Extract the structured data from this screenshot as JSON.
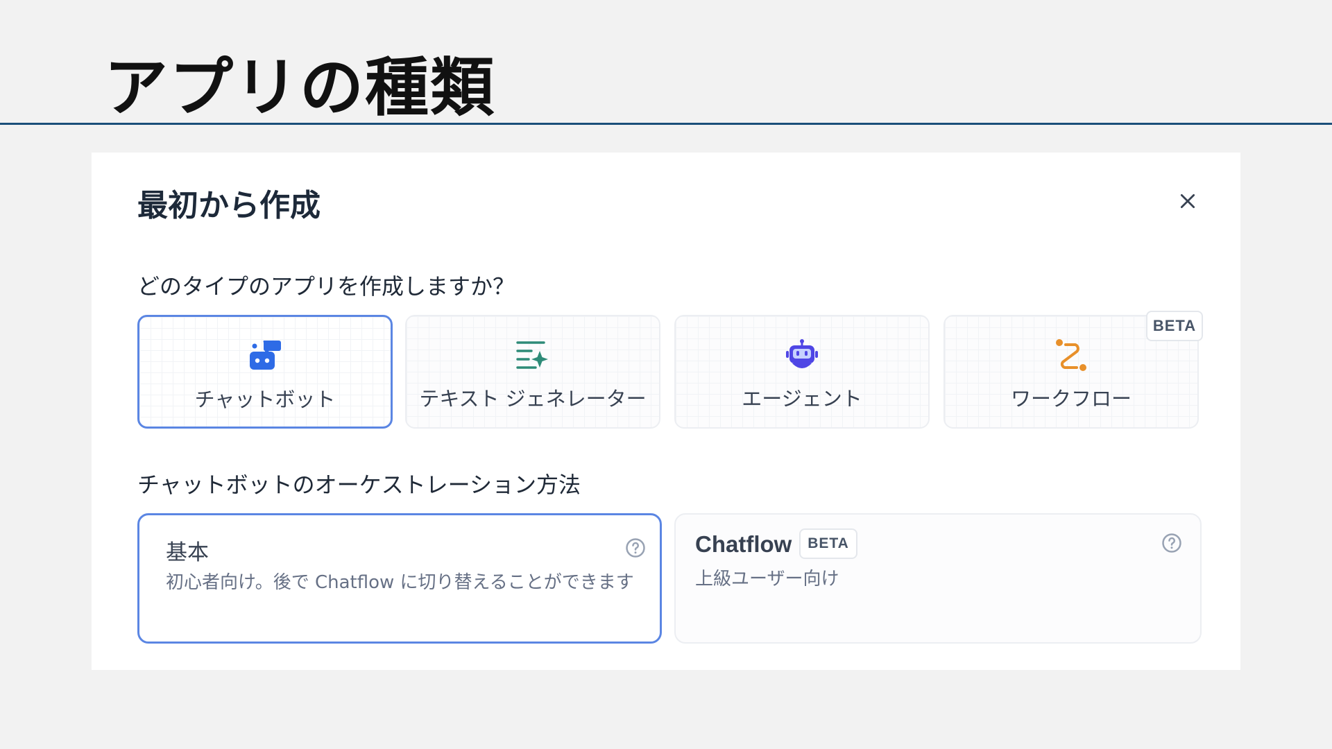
{
  "slide": {
    "title": "アプリの種類"
  },
  "dialog": {
    "title": "最初から作成",
    "close_icon": "close-icon",
    "app_type_question": "どのタイプのアプリを作成しますか？",
    "app_types": [
      {
        "label": "チャットボット",
        "icon": "chatbot-icon",
        "color": "#2e6be6",
        "selected": true
      },
      {
        "label": "テキスト ジェネレーター",
        "icon": "text-generator-icon",
        "color": "#2e8b78",
        "selected": false
      },
      {
        "label": "エージェント",
        "icon": "agent-robot-icon",
        "color": "#4f46e5",
        "selected": false
      },
      {
        "label": "ワークフロー",
        "icon": "workflow-icon",
        "color": "#e8902a",
        "selected": false
      }
    ],
    "workflow_badge": "BETA",
    "orchestration_label": "チャットボットのオーケストレーション方法",
    "orchestration": {
      "basic": {
        "title": "基本",
        "description": "初心者向け。後で Chatflow に切り替えることができます",
        "selected": true
      },
      "chatflow": {
        "title": "Chatflow",
        "badge": "BETA",
        "description": "上級ユーザー向け",
        "selected": false
      }
    }
  },
  "colors": {
    "accent": "#5b86e3",
    "header_rule": "#1b4f7a"
  }
}
